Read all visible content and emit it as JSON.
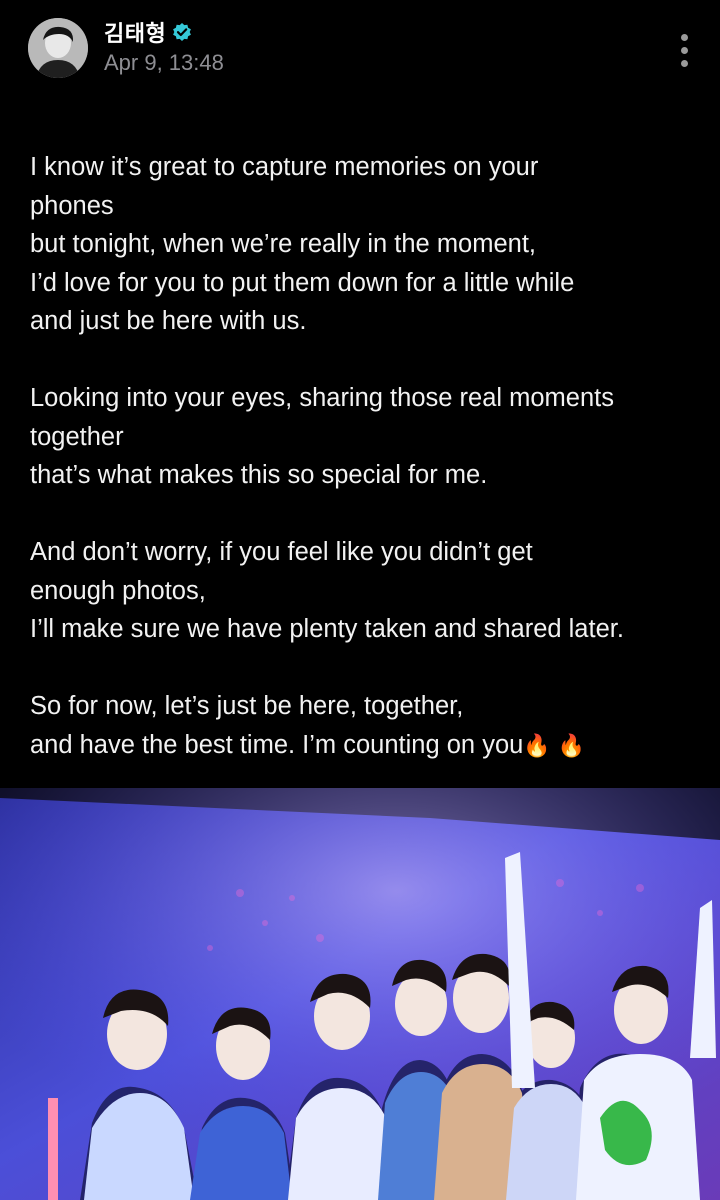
{
  "post": {
    "author": "김태형",
    "verified": true,
    "timestamp": "Apr 9, 13:48",
    "more_icon": "more-vertical-icon",
    "paragraphs": [
      [
        "I know it’s great to capture memories on your",
        "phones",
        "but tonight, when we’re really in the moment,",
        "I’d love for you to put them down for a little while",
        "and just be here with us."
      ],
      [
        "Looking into your eyes, sharing those real moments",
        "together",
        "that’s what makes this so special for me."
      ],
      [
        "And don’t worry, if you feel like you didn’t get",
        "enough photos,",
        "I’ll make sure we have plenty taken and shared later."
      ],
      [
        "So for now, let’s just be here, together,",
        "and have the best time. I’m counting on you"
      ]
    ],
    "emojis": [
      "🔥",
      "🔥"
    ]
  },
  "colors": {
    "background": "#000000",
    "text": "#f2f2f2",
    "muted": "#8e8e93",
    "verified": "#35c9d8",
    "stage_light": "#4b4fd8"
  }
}
